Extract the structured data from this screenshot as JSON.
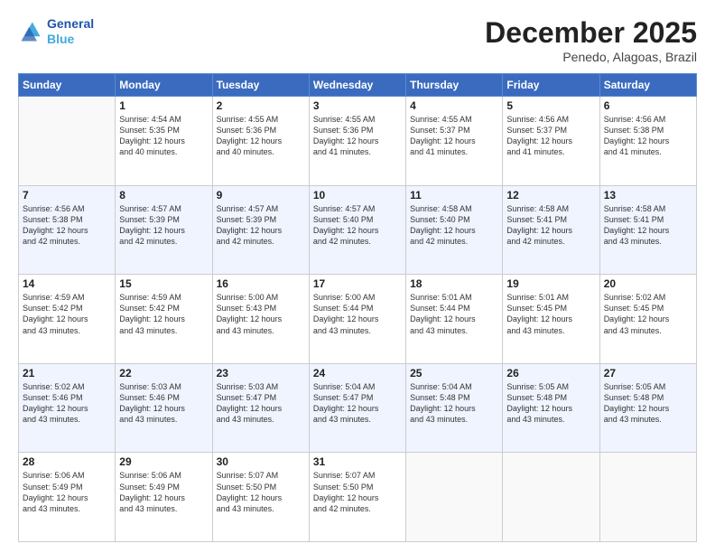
{
  "header": {
    "logo_line1": "General",
    "logo_line2": "Blue",
    "month_title": "December 2025",
    "location": "Penedo, Alagoas, Brazil"
  },
  "days": [
    "Sunday",
    "Monday",
    "Tuesday",
    "Wednesday",
    "Thursday",
    "Friday",
    "Saturday"
  ],
  "weeks": [
    [
      {
        "date": "",
        "info": ""
      },
      {
        "date": "1",
        "info": "Sunrise: 4:54 AM\nSunset: 5:35 PM\nDaylight: 12 hours\nand 40 minutes."
      },
      {
        "date": "2",
        "info": "Sunrise: 4:55 AM\nSunset: 5:36 PM\nDaylight: 12 hours\nand 40 minutes."
      },
      {
        "date": "3",
        "info": "Sunrise: 4:55 AM\nSunset: 5:36 PM\nDaylight: 12 hours\nand 41 minutes."
      },
      {
        "date": "4",
        "info": "Sunrise: 4:55 AM\nSunset: 5:37 PM\nDaylight: 12 hours\nand 41 minutes."
      },
      {
        "date": "5",
        "info": "Sunrise: 4:56 AM\nSunset: 5:37 PM\nDaylight: 12 hours\nand 41 minutes."
      },
      {
        "date": "6",
        "info": "Sunrise: 4:56 AM\nSunset: 5:38 PM\nDaylight: 12 hours\nand 41 minutes."
      }
    ],
    [
      {
        "date": "7",
        "info": "Sunrise: 4:56 AM\nSunset: 5:38 PM\nDaylight: 12 hours\nand 42 minutes."
      },
      {
        "date": "8",
        "info": "Sunrise: 4:57 AM\nSunset: 5:39 PM\nDaylight: 12 hours\nand 42 minutes."
      },
      {
        "date": "9",
        "info": "Sunrise: 4:57 AM\nSunset: 5:39 PM\nDaylight: 12 hours\nand 42 minutes."
      },
      {
        "date": "10",
        "info": "Sunrise: 4:57 AM\nSunset: 5:40 PM\nDaylight: 12 hours\nand 42 minutes."
      },
      {
        "date": "11",
        "info": "Sunrise: 4:58 AM\nSunset: 5:40 PM\nDaylight: 12 hours\nand 42 minutes."
      },
      {
        "date": "12",
        "info": "Sunrise: 4:58 AM\nSunset: 5:41 PM\nDaylight: 12 hours\nand 42 minutes."
      },
      {
        "date": "13",
        "info": "Sunrise: 4:58 AM\nSunset: 5:41 PM\nDaylight: 12 hours\nand 43 minutes."
      }
    ],
    [
      {
        "date": "14",
        "info": "Sunrise: 4:59 AM\nSunset: 5:42 PM\nDaylight: 12 hours\nand 43 minutes."
      },
      {
        "date": "15",
        "info": "Sunrise: 4:59 AM\nSunset: 5:42 PM\nDaylight: 12 hours\nand 43 minutes."
      },
      {
        "date": "16",
        "info": "Sunrise: 5:00 AM\nSunset: 5:43 PM\nDaylight: 12 hours\nand 43 minutes."
      },
      {
        "date": "17",
        "info": "Sunrise: 5:00 AM\nSunset: 5:44 PM\nDaylight: 12 hours\nand 43 minutes."
      },
      {
        "date": "18",
        "info": "Sunrise: 5:01 AM\nSunset: 5:44 PM\nDaylight: 12 hours\nand 43 minutes."
      },
      {
        "date": "19",
        "info": "Sunrise: 5:01 AM\nSunset: 5:45 PM\nDaylight: 12 hours\nand 43 minutes."
      },
      {
        "date": "20",
        "info": "Sunrise: 5:02 AM\nSunset: 5:45 PM\nDaylight: 12 hours\nand 43 minutes."
      }
    ],
    [
      {
        "date": "21",
        "info": "Sunrise: 5:02 AM\nSunset: 5:46 PM\nDaylight: 12 hours\nand 43 minutes."
      },
      {
        "date": "22",
        "info": "Sunrise: 5:03 AM\nSunset: 5:46 PM\nDaylight: 12 hours\nand 43 minutes."
      },
      {
        "date": "23",
        "info": "Sunrise: 5:03 AM\nSunset: 5:47 PM\nDaylight: 12 hours\nand 43 minutes."
      },
      {
        "date": "24",
        "info": "Sunrise: 5:04 AM\nSunset: 5:47 PM\nDaylight: 12 hours\nand 43 minutes."
      },
      {
        "date": "25",
        "info": "Sunrise: 5:04 AM\nSunset: 5:48 PM\nDaylight: 12 hours\nand 43 minutes."
      },
      {
        "date": "26",
        "info": "Sunrise: 5:05 AM\nSunset: 5:48 PM\nDaylight: 12 hours\nand 43 minutes."
      },
      {
        "date": "27",
        "info": "Sunrise: 5:05 AM\nSunset: 5:48 PM\nDaylight: 12 hours\nand 43 minutes."
      }
    ],
    [
      {
        "date": "28",
        "info": "Sunrise: 5:06 AM\nSunset: 5:49 PM\nDaylight: 12 hours\nand 43 minutes."
      },
      {
        "date": "29",
        "info": "Sunrise: 5:06 AM\nSunset: 5:49 PM\nDaylight: 12 hours\nand 43 minutes."
      },
      {
        "date": "30",
        "info": "Sunrise: 5:07 AM\nSunset: 5:50 PM\nDaylight: 12 hours\nand 43 minutes."
      },
      {
        "date": "31",
        "info": "Sunrise: 5:07 AM\nSunset: 5:50 PM\nDaylight: 12 hours\nand 42 minutes."
      },
      {
        "date": "",
        "info": ""
      },
      {
        "date": "",
        "info": ""
      },
      {
        "date": "",
        "info": ""
      }
    ]
  ]
}
